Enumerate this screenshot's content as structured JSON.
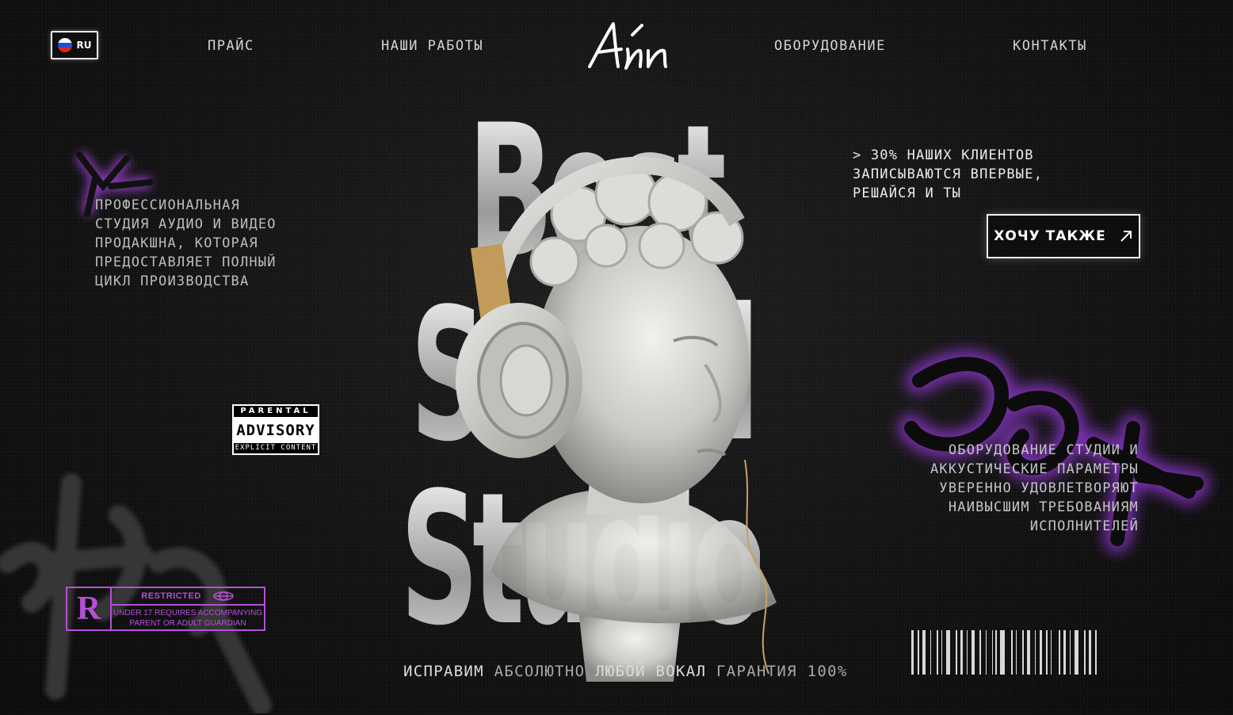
{
  "language": {
    "code": "RU",
    "icon": "russia-flag-icon"
  },
  "nav": {
    "price": "ПРАЙС",
    "works": "НАШИ РАБОТЫ",
    "equipment": "ОБОРУДОВАНИЕ",
    "contacts": "КОНТАКТЫ"
  },
  "logo": {
    "text": "Áйn"
  },
  "hero": {
    "words": [
      "Best",
      "Sound",
      "Studio"
    ],
    "slogan": {
      "part1": "ИСПРАВИМ",
      "part2": "АБСОЛЮТНО",
      "part3": "ЛЮБОЙ",
      "part4": "ВОКАЛ",
      "part5": "ГАРАНТИЯ 100%"
    }
  },
  "intro": {
    "text": "ПРОФЕССИОНАЛЬНАЯ\nСТУДИЯ АУДИО И ВИДЕО\nПРОДАКШНА, КОТОРАЯ\nПРЕДОСТАВЛЯЕТ ПОЛНЫЙ\nЦИКЛ ПРОИЗВОДСТВА"
  },
  "stat": {
    "text": "> 30% НАШИХ КЛИЕНТОВ\nЗАПИСЫВАЮТСЯ ВПЕРВЫЕ,\nРЕШАЙСЯ И ТЫ"
  },
  "cta": {
    "label": "ХОЧУ ТАКЖЕ",
    "icon": "arrow-up-right-icon"
  },
  "equipment_note": {
    "text": "ОБОРУДОВАНИЕ СТУДИИ И\nАККУСТИЧЕСКИЕ ПАРАМЕТРЫ\nУВЕРЕННО УДОВЛЕТВОРЯЮТ\nНАИВЫСШИМ ТРЕБОВАНИЯМ\nИСПОЛНИТЕЛЕЙ"
  },
  "advisory": {
    "top": "PARENTAL",
    "main": "ADVISORY",
    "bottom": "EXPLICIT CONTENT"
  },
  "rating": {
    "letter": "R",
    "title": "RESTRICTED",
    "description": "UNDER 17 REQUIRES ACCOMPANYING PARENT OR ADULT GUARDIAN"
  },
  "colors": {
    "accent_purple": "#b54fd8",
    "background": "#0e0e0e",
    "text": "#d9d9d9"
  }
}
